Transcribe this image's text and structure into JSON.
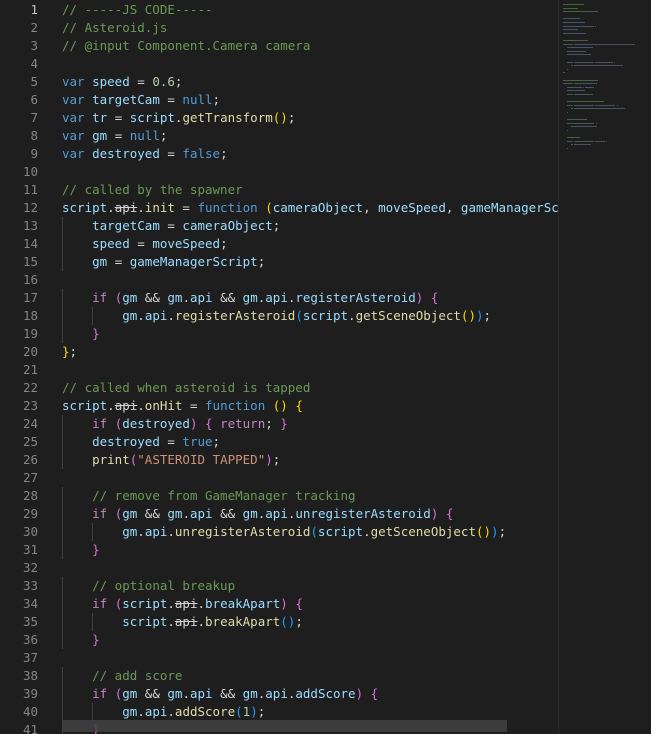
{
  "editor": {
    "active_line": "1",
    "lines": [
      {
        "n": "1",
        "segs": [
          {
            "c": "cm",
            "t": "// -----JS CODE-----"
          }
        ]
      },
      {
        "n": "2",
        "segs": [
          {
            "c": "cm",
            "t": "// Asteroid.js"
          }
        ]
      },
      {
        "n": "3",
        "segs": [
          {
            "c": "cm",
            "t": "// @input Component.Camera camera"
          }
        ]
      },
      {
        "n": "4",
        "segs": []
      },
      {
        "n": "5",
        "segs": [
          {
            "c": "kw",
            "t": "var "
          },
          {
            "c": "vr",
            "t": "speed"
          },
          {
            "c": "pl",
            "t": " = "
          },
          {
            "c": "num",
            "t": "0.6"
          },
          {
            "c": "pl",
            "t": ";"
          }
        ]
      },
      {
        "n": "6",
        "segs": [
          {
            "c": "kw",
            "t": "var "
          },
          {
            "c": "vr",
            "t": "targetCam"
          },
          {
            "c": "pl",
            "t": " = "
          },
          {
            "c": "kw",
            "t": "null"
          },
          {
            "c": "pl",
            "t": ";"
          }
        ]
      },
      {
        "n": "7",
        "segs": [
          {
            "c": "kw",
            "t": "var "
          },
          {
            "c": "vr",
            "t": "tr"
          },
          {
            "c": "pl",
            "t": " = "
          },
          {
            "c": "vr",
            "t": "script"
          },
          {
            "c": "pl",
            "t": "."
          },
          {
            "c": "fn",
            "t": "getTransform"
          },
          {
            "c": "p1",
            "t": "()"
          },
          {
            "c": "pl",
            "t": ";"
          }
        ]
      },
      {
        "n": "8",
        "segs": [
          {
            "c": "kw",
            "t": "var "
          },
          {
            "c": "vr",
            "t": "gm"
          },
          {
            "c": "pl",
            "t": " = "
          },
          {
            "c": "kw",
            "t": "null"
          },
          {
            "c": "pl",
            "t": ";"
          }
        ]
      },
      {
        "n": "9",
        "segs": [
          {
            "c": "kw",
            "t": "var "
          },
          {
            "c": "vr",
            "t": "destroyed"
          },
          {
            "c": "pl",
            "t": " = "
          },
          {
            "c": "kw",
            "t": "false"
          },
          {
            "c": "pl",
            "t": ";"
          }
        ]
      },
      {
        "n": "10",
        "segs": []
      },
      {
        "n": "11",
        "segs": [
          {
            "c": "cm",
            "t": "// called by the spawner"
          }
        ]
      },
      {
        "n": "12",
        "segs": [
          {
            "c": "vr",
            "t": "script"
          },
          {
            "c": "pl",
            "t": "."
          },
          {
            "c": "dep",
            "t": "api"
          },
          {
            "c": "pl",
            "t": "."
          },
          {
            "c": "fn",
            "t": "init"
          },
          {
            "c": "pl",
            "t": " = "
          },
          {
            "c": "kw",
            "t": "function "
          },
          {
            "c": "p1",
            "t": "("
          },
          {
            "c": "vr",
            "t": "cameraObject"
          },
          {
            "c": "pl",
            "t": ", "
          },
          {
            "c": "vr",
            "t": "moveSpeed"
          },
          {
            "c": "pl",
            "t": ", "
          },
          {
            "c": "vr",
            "t": "gameManagerScrip"
          }
        ]
      },
      {
        "n": "13",
        "segs": [
          {
            "c": "pl",
            "t": "    "
          },
          {
            "c": "vr",
            "t": "targetCam"
          },
          {
            "c": "pl",
            "t": " = "
          },
          {
            "c": "vr",
            "t": "cameraObject"
          },
          {
            "c": "pl",
            "t": ";"
          }
        ]
      },
      {
        "n": "14",
        "segs": [
          {
            "c": "pl",
            "t": "    "
          },
          {
            "c": "vr",
            "t": "speed"
          },
          {
            "c": "pl",
            "t": " = "
          },
          {
            "c": "vr",
            "t": "moveSpeed"
          },
          {
            "c": "pl",
            "t": ";"
          }
        ]
      },
      {
        "n": "15",
        "segs": [
          {
            "c": "pl",
            "t": "    "
          },
          {
            "c": "vr",
            "t": "gm"
          },
          {
            "c": "pl",
            "t": " = "
          },
          {
            "c": "vr",
            "t": "gameManagerScript"
          },
          {
            "c": "pl",
            "t": ";"
          }
        ]
      },
      {
        "n": "16",
        "segs": []
      },
      {
        "n": "17",
        "segs": [
          {
            "c": "pl",
            "t": "    "
          },
          {
            "c": "ctl",
            "t": "if "
          },
          {
            "c": "p2",
            "t": "("
          },
          {
            "c": "vr",
            "t": "gm"
          },
          {
            "c": "pl",
            "t": " && "
          },
          {
            "c": "vr",
            "t": "gm"
          },
          {
            "c": "pl",
            "t": "."
          },
          {
            "c": "vr",
            "t": "api"
          },
          {
            "c": "pl",
            "t": " && "
          },
          {
            "c": "vr",
            "t": "gm"
          },
          {
            "c": "pl",
            "t": "."
          },
          {
            "c": "vr",
            "t": "api"
          },
          {
            "c": "pl",
            "t": "."
          },
          {
            "c": "vr",
            "t": "registerAsteroid"
          },
          {
            "c": "p2",
            "t": ")"
          },
          {
            "c": "pl",
            "t": " "
          },
          {
            "c": "p2",
            "t": "{"
          }
        ]
      },
      {
        "n": "18",
        "segs": [
          {
            "c": "pl",
            "t": "        "
          },
          {
            "c": "vr",
            "t": "gm"
          },
          {
            "c": "pl",
            "t": "."
          },
          {
            "c": "vr",
            "t": "api"
          },
          {
            "c": "pl",
            "t": "."
          },
          {
            "c": "fn",
            "t": "registerAsteroid"
          },
          {
            "c": "p3",
            "t": "("
          },
          {
            "c": "vr",
            "t": "script"
          },
          {
            "c": "pl",
            "t": "."
          },
          {
            "c": "fn",
            "t": "getSceneObject"
          },
          {
            "c": "p1",
            "t": "()"
          },
          {
            "c": "p3",
            "t": ")"
          },
          {
            "c": "pl",
            "t": ";"
          }
        ]
      },
      {
        "n": "19",
        "segs": [
          {
            "c": "pl",
            "t": "    "
          },
          {
            "c": "p2",
            "t": "}"
          }
        ]
      },
      {
        "n": "20",
        "segs": [
          {
            "c": "p1",
            "t": "}"
          },
          {
            "c": "pl",
            "t": ";"
          }
        ]
      },
      {
        "n": "21",
        "segs": []
      },
      {
        "n": "22",
        "segs": [
          {
            "c": "cm",
            "t": "// called when asteroid is tapped"
          }
        ]
      },
      {
        "n": "23",
        "segs": [
          {
            "c": "vr",
            "t": "script"
          },
          {
            "c": "pl",
            "t": "."
          },
          {
            "c": "dep",
            "t": "api"
          },
          {
            "c": "pl",
            "t": "."
          },
          {
            "c": "fn",
            "t": "onHit"
          },
          {
            "c": "pl",
            "t": " = "
          },
          {
            "c": "kw",
            "t": "function "
          },
          {
            "c": "p1",
            "t": "() {"
          }
        ]
      },
      {
        "n": "24",
        "segs": [
          {
            "c": "pl",
            "t": "    "
          },
          {
            "c": "ctl",
            "t": "if "
          },
          {
            "c": "p2",
            "t": "("
          },
          {
            "c": "vr",
            "t": "destroyed"
          },
          {
            "c": "p2",
            "t": ")"
          },
          {
            "c": "pl",
            "t": " "
          },
          {
            "c": "p2",
            "t": "{"
          },
          {
            "c": "pl",
            "t": " "
          },
          {
            "c": "ctl",
            "t": "return"
          },
          {
            "c": "pl",
            "t": "; "
          },
          {
            "c": "p2",
            "t": "}"
          }
        ]
      },
      {
        "n": "25",
        "segs": [
          {
            "c": "pl",
            "t": "    "
          },
          {
            "c": "vr",
            "t": "destroyed"
          },
          {
            "c": "pl",
            "t": " = "
          },
          {
            "c": "kw",
            "t": "true"
          },
          {
            "c": "pl",
            "t": ";"
          }
        ]
      },
      {
        "n": "26",
        "segs": [
          {
            "c": "pl",
            "t": "    "
          },
          {
            "c": "fn",
            "t": "print"
          },
          {
            "c": "p2",
            "t": "("
          },
          {
            "c": "str",
            "t": "\"ASTEROID TAPPED\""
          },
          {
            "c": "p2",
            "t": ")"
          },
          {
            "c": "pl",
            "t": ";"
          }
        ]
      },
      {
        "n": "27",
        "segs": []
      },
      {
        "n": "28",
        "segs": [
          {
            "c": "pl",
            "t": "    "
          },
          {
            "c": "cm",
            "t": "// remove from GameManager tracking"
          }
        ]
      },
      {
        "n": "29",
        "segs": [
          {
            "c": "pl",
            "t": "    "
          },
          {
            "c": "ctl",
            "t": "if "
          },
          {
            "c": "p2",
            "t": "("
          },
          {
            "c": "vr",
            "t": "gm"
          },
          {
            "c": "pl",
            "t": " && "
          },
          {
            "c": "vr",
            "t": "gm"
          },
          {
            "c": "pl",
            "t": "."
          },
          {
            "c": "vr",
            "t": "api"
          },
          {
            "c": "pl",
            "t": " && "
          },
          {
            "c": "vr",
            "t": "gm"
          },
          {
            "c": "pl",
            "t": "."
          },
          {
            "c": "vr",
            "t": "api"
          },
          {
            "c": "pl",
            "t": "."
          },
          {
            "c": "vr",
            "t": "unregisterAsteroid"
          },
          {
            "c": "p2",
            "t": ")"
          },
          {
            "c": "pl",
            "t": " "
          },
          {
            "c": "p2",
            "t": "{"
          }
        ]
      },
      {
        "n": "30",
        "segs": [
          {
            "c": "pl",
            "t": "        "
          },
          {
            "c": "vr",
            "t": "gm"
          },
          {
            "c": "pl",
            "t": "."
          },
          {
            "c": "vr",
            "t": "api"
          },
          {
            "c": "pl",
            "t": "."
          },
          {
            "c": "fn",
            "t": "unregisterAsteroid"
          },
          {
            "c": "p3",
            "t": "("
          },
          {
            "c": "vr",
            "t": "script"
          },
          {
            "c": "pl",
            "t": "."
          },
          {
            "c": "fn",
            "t": "getSceneObject"
          },
          {
            "c": "p1",
            "t": "()"
          },
          {
            "c": "p3",
            "t": ")"
          },
          {
            "c": "pl",
            "t": ";"
          }
        ]
      },
      {
        "n": "31",
        "segs": [
          {
            "c": "pl",
            "t": "    "
          },
          {
            "c": "p2",
            "t": "}"
          }
        ]
      },
      {
        "n": "32",
        "segs": []
      },
      {
        "n": "33",
        "segs": [
          {
            "c": "pl",
            "t": "    "
          },
          {
            "c": "cm",
            "t": "// optional breakup"
          }
        ]
      },
      {
        "n": "34",
        "segs": [
          {
            "c": "pl",
            "t": "    "
          },
          {
            "c": "ctl",
            "t": "if "
          },
          {
            "c": "p2",
            "t": "("
          },
          {
            "c": "vr",
            "t": "script"
          },
          {
            "c": "pl",
            "t": "."
          },
          {
            "c": "dep",
            "t": "api"
          },
          {
            "c": "pl",
            "t": "."
          },
          {
            "c": "vr",
            "t": "breakApart"
          },
          {
            "c": "p2",
            "t": ")"
          },
          {
            "c": "pl",
            "t": " "
          },
          {
            "c": "p2",
            "t": "{"
          }
        ]
      },
      {
        "n": "35",
        "segs": [
          {
            "c": "pl",
            "t": "        "
          },
          {
            "c": "vr",
            "t": "script"
          },
          {
            "c": "pl",
            "t": "."
          },
          {
            "c": "dep",
            "t": "api"
          },
          {
            "c": "pl",
            "t": "."
          },
          {
            "c": "fn",
            "t": "breakApart"
          },
          {
            "c": "p3",
            "t": "()"
          },
          {
            "c": "pl",
            "t": ";"
          }
        ]
      },
      {
        "n": "36",
        "segs": [
          {
            "c": "pl",
            "t": "    "
          },
          {
            "c": "p2",
            "t": "}"
          }
        ]
      },
      {
        "n": "37",
        "segs": []
      },
      {
        "n": "38",
        "segs": [
          {
            "c": "pl",
            "t": "    "
          },
          {
            "c": "cm",
            "t": "// add score"
          }
        ]
      },
      {
        "n": "39",
        "segs": [
          {
            "c": "pl",
            "t": "    "
          },
          {
            "c": "ctl",
            "t": "if "
          },
          {
            "c": "p2",
            "t": "("
          },
          {
            "c": "vr",
            "t": "gm"
          },
          {
            "c": "pl",
            "t": " && "
          },
          {
            "c": "vr",
            "t": "gm"
          },
          {
            "c": "pl",
            "t": "."
          },
          {
            "c": "vr",
            "t": "api"
          },
          {
            "c": "pl",
            "t": " && "
          },
          {
            "c": "vr",
            "t": "gm"
          },
          {
            "c": "pl",
            "t": "."
          },
          {
            "c": "vr",
            "t": "api"
          },
          {
            "c": "pl",
            "t": "."
          },
          {
            "c": "vr",
            "t": "addScore"
          },
          {
            "c": "p2",
            "t": ")"
          },
          {
            "c": "pl",
            "t": " "
          },
          {
            "c": "p2",
            "t": "{"
          }
        ]
      },
      {
        "n": "40",
        "segs": [
          {
            "c": "pl",
            "t": "        "
          },
          {
            "c": "vr",
            "t": "gm"
          },
          {
            "c": "pl",
            "t": "."
          },
          {
            "c": "vr",
            "t": "api"
          },
          {
            "c": "pl",
            "t": "."
          },
          {
            "c": "fn",
            "t": "addScore"
          },
          {
            "c": "p3",
            "t": "("
          },
          {
            "c": "num",
            "t": "1"
          },
          {
            "c": "p3",
            "t": ")"
          },
          {
            "c": "pl",
            "t": ";"
          }
        ]
      },
      {
        "n": "41",
        "segs": [
          {
            "c": "pl",
            "t": "    "
          },
          {
            "c": "p2",
            "t": "}"
          }
        ]
      }
    ]
  },
  "colors": {
    "background": "#1e1e1e",
    "comment": "#6a9955",
    "keyword": "#569cd6",
    "control": "#c586c0",
    "variable": "#9cdcfe",
    "function": "#dcdcaa",
    "number": "#b5cea8",
    "string": "#ce9178"
  }
}
